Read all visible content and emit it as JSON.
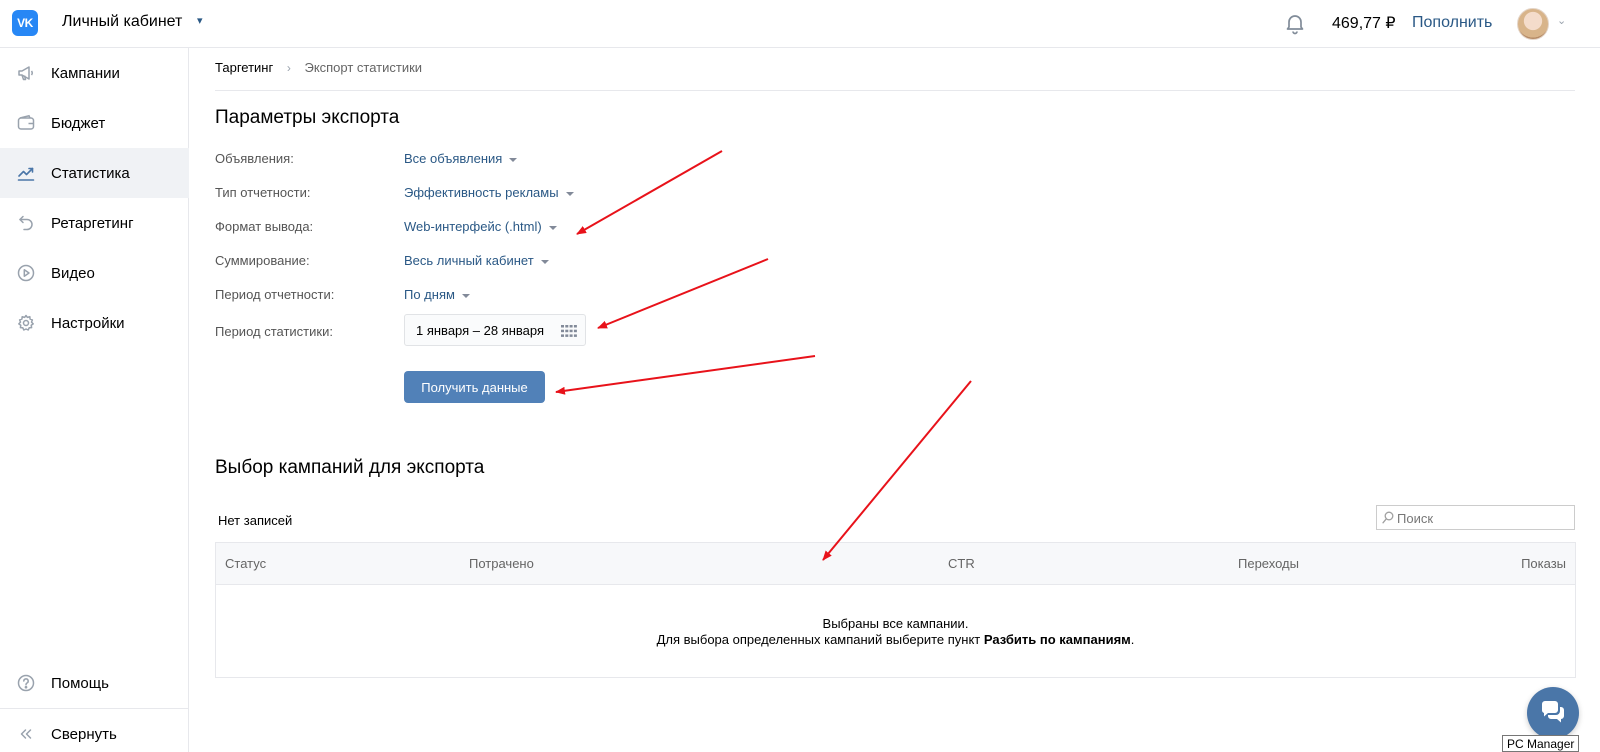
{
  "header": {
    "logo_text": "VK",
    "title": "Личный кабинет",
    "balance": "469,77 ₽",
    "topup_label": "Пополнить"
  },
  "sidebar": {
    "items": [
      {
        "label": "Кампании",
        "icon": "megaphone-icon"
      },
      {
        "label": "Бюджет",
        "icon": "wallet-icon"
      },
      {
        "label": "Статистика",
        "icon": "chart-line-icon",
        "active": true
      },
      {
        "label": "Ретаргетинг",
        "icon": "retarget-arrow-icon"
      },
      {
        "label": "Видео",
        "icon": "play-circle-icon"
      },
      {
        "label": "Настройки",
        "icon": "gear-icon"
      }
    ],
    "help_label": "Помощь",
    "collapse_label": "Свернуть"
  },
  "breadcrumb": {
    "items": [
      "Таргетинг",
      "Экспорт статистики"
    ],
    "separator": "›"
  },
  "export_params": {
    "title": "Параметры экспорта",
    "rows": [
      {
        "label": "Объявления:",
        "value": "Все объявления"
      },
      {
        "label": "Тип отчетности:",
        "value": "Эффективность рекламы"
      },
      {
        "label": "Формат вывода:",
        "value": "Web-интерфейс (.html)"
      },
      {
        "label": "Суммирование:",
        "value": "Весь личный кабинет"
      },
      {
        "label": "Период отчетности:",
        "value": "По дням"
      }
    ],
    "period_label": "Период статистики:",
    "period_value": "1 января – 28 января",
    "submit_label": "Получить данные"
  },
  "campaign_selection": {
    "title": "Выбор кампаний для экспорта",
    "no_records": "Нет записей",
    "search_placeholder": "Поиск",
    "columns": [
      "Статус",
      "Потрачено",
      "CTR",
      "Переходы",
      "Показы"
    ],
    "empty_line1": "Выбраны все кампании.",
    "empty_line2_prefix": "Для выбора определенных кампаний выберите пункт",
    "empty_line2_bold": "Разбить по кампаниям",
    "empty_line2_suffix": "."
  },
  "tooltip": "PC Manager",
  "colors": {
    "accent": "#2a5885",
    "button": "#5181b8",
    "logo": "#2787f5",
    "annotation_arrow": "#e8121a",
    "active_nav_bg": "#f0f2f5"
  }
}
